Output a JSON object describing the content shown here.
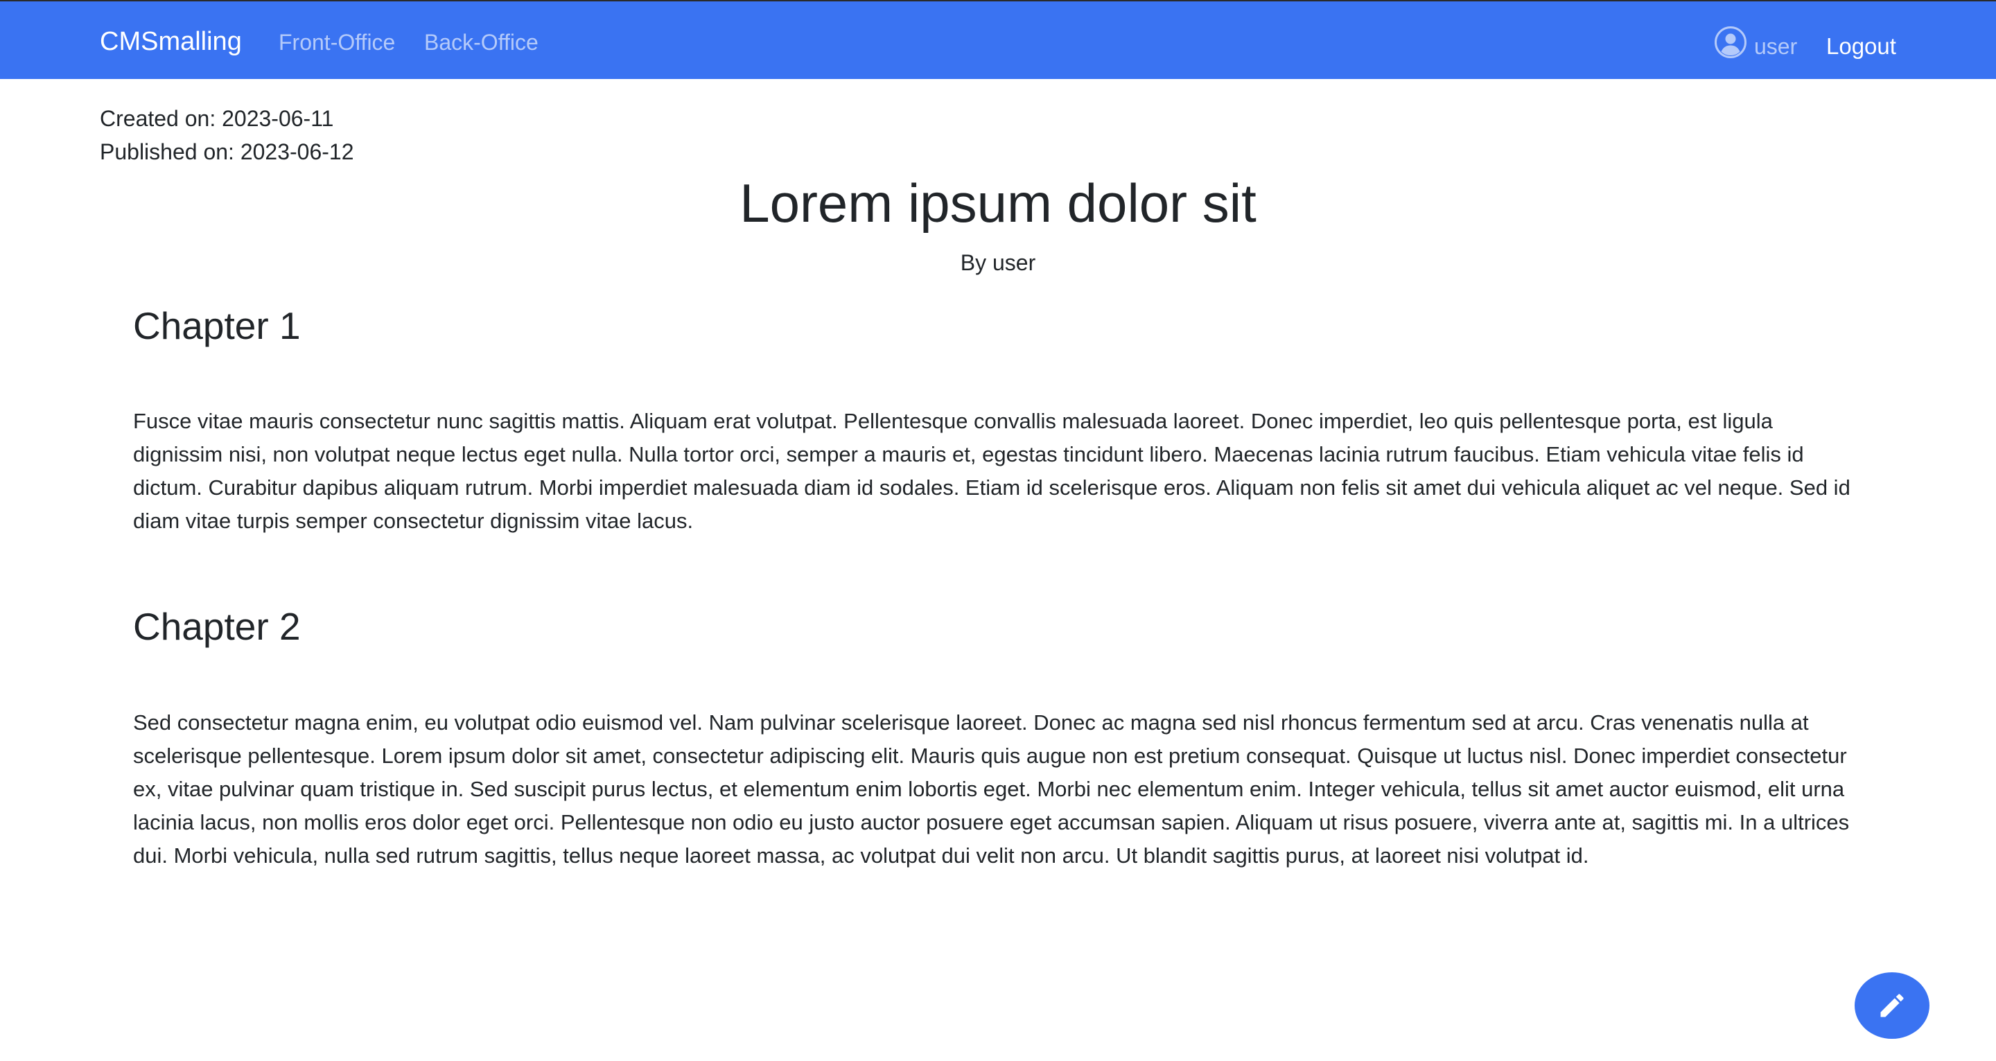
{
  "navbar": {
    "brand": "CMSmalling",
    "links": [
      "Front-Office",
      "Back-Office"
    ],
    "user_label": "user",
    "logout_label": "Logout",
    "background": "#3a73f2"
  },
  "article": {
    "created": "Created on: 2023-06-11",
    "published": "Published on: 2023-06-12",
    "title": "Lorem ipsum dolor sit",
    "byline": "By user",
    "chapters": [
      {
        "heading": "Chapter 1",
        "body": "Fusce vitae mauris consectetur nunc sagittis mattis. Aliquam erat volutpat. Pellentesque convallis malesuada laoreet. Donec imperdiet, leo quis pellentesque porta, est ligula dignissim nisi, non volutpat neque lectus eget nulla. Nulla tortor orci, semper a mauris et, egestas tincidunt libero. Maecenas lacinia rutrum faucibus. Etiam vehicula vitae felis id dictum. Curabitur dapibus aliquam rutrum. Morbi imperdiet malesuada diam id sodales. Etiam id scelerisque eros. Aliquam non felis sit amet dui vehicula aliquet ac vel neque. Sed id diam vitae turpis semper consectetur dignissim vitae lacus."
      },
      {
        "heading": "Chapter 2",
        "body": "Sed consectetur magna enim, eu volutpat odio euismod vel. Nam pulvinar scelerisque laoreet. Donec ac magna sed nisl rhoncus fermentum sed at arcu. Cras venenatis nulla at scelerisque pellentesque. Lorem ipsum dolor sit amet, consectetur adipiscing elit. Mauris quis augue non est pretium consequat. Quisque ut luctus nisl. Donec imperdiet consectetur ex, vitae pulvinar quam tristique in. Sed suscipit purus lectus, et elementum enim lobortis eget. Morbi nec elementum enim. Integer vehicula, tellus sit amet auctor euismod, elit urna lacinia lacus, non mollis eros dolor eget orci. Pellentesque non odio eu justo auctor posuere eget accumsan sapien. Aliquam ut risus posuere, viverra ante at, sagittis mi. In a ultrices dui. Morbi vehicula, nulla sed rutrum sagittis, tellus neque laoreet massa, ac volutpat dui velit non arcu. Ut blandit sagittis purus, at laoreet nisi volutpat id."
      }
    ]
  },
  "fab": {
    "icon": "pencil-icon"
  }
}
